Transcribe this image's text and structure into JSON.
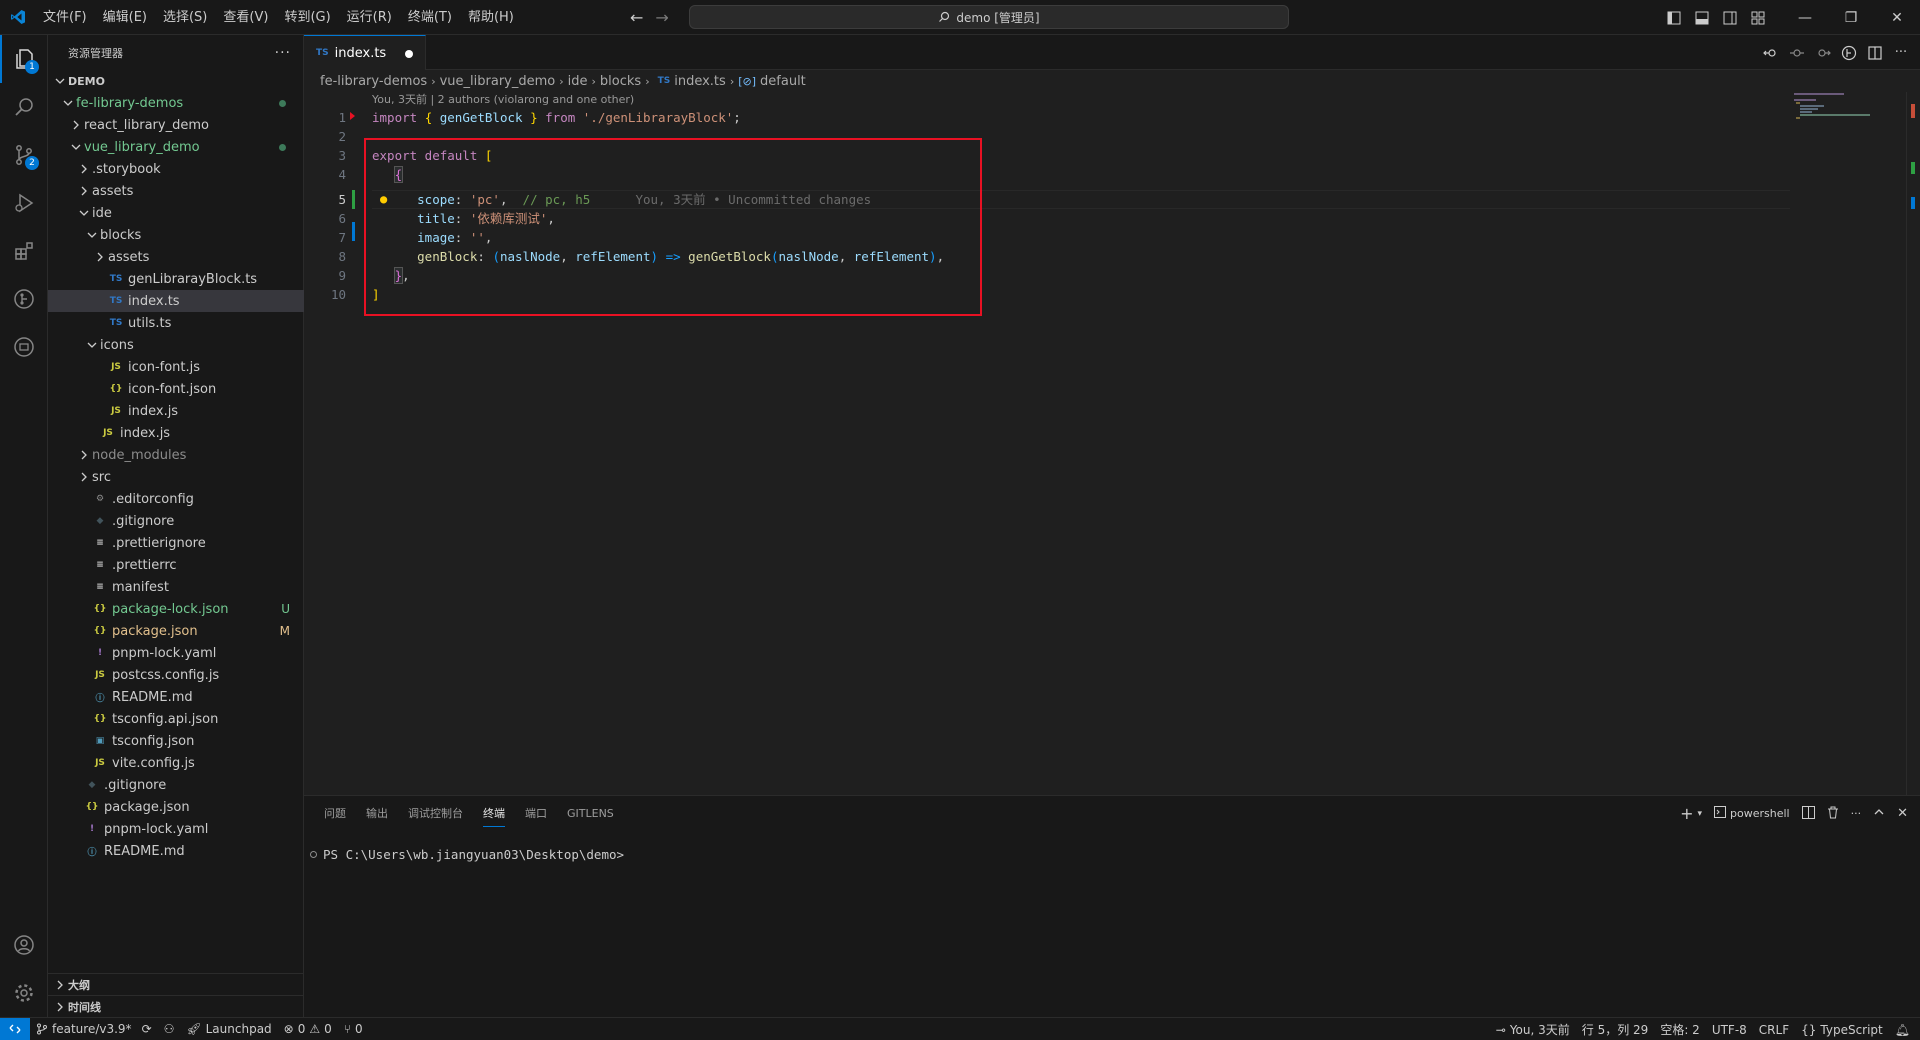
{
  "menu": [
    "文件(F)",
    "编辑(E)",
    "选择(S)",
    "查看(V)",
    "转到(G)",
    "运行(R)",
    "终端(T)",
    "帮助(H)"
  ],
  "command_center": "demo [管理员]",
  "sidebar": {
    "title": "资源管理器",
    "root": "DEMO",
    "items": [
      {
        "label": "fe-library-demos",
        "depth": 1,
        "type": "folder-open",
        "status": "dot",
        "color": "green"
      },
      {
        "label": "react_library_demo",
        "depth": 2,
        "type": "folder",
        "status": "",
        "color": ""
      },
      {
        "label": "vue_library_demo",
        "depth": 2,
        "type": "folder-open",
        "status": "dot",
        "color": "green"
      },
      {
        "label": ".storybook",
        "depth": 3,
        "type": "folder",
        "status": "",
        "color": ""
      },
      {
        "label": "assets",
        "depth": 3,
        "type": "folder",
        "status": "",
        "color": ""
      },
      {
        "label": "ide",
        "depth": 3,
        "type": "folder-open",
        "status": "",
        "color": ""
      },
      {
        "label": "blocks",
        "depth": 4,
        "type": "folder-open",
        "status": "",
        "color": ""
      },
      {
        "label": "assets",
        "depth": 5,
        "type": "folder",
        "status": "",
        "color": ""
      },
      {
        "label": "genLibrarayBlock.ts",
        "depth": 5,
        "type": "ts",
        "status": "",
        "color": ""
      },
      {
        "label": "index.ts",
        "depth": 5,
        "type": "ts",
        "status": "",
        "color": "",
        "selected": true
      },
      {
        "label": "utils.ts",
        "depth": 5,
        "type": "ts",
        "status": "",
        "color": ""
      },
      {
        "label": "icons",
        "depth": 4,
        "type": "folder-open",
        "status": "",
        "color": ""
      },
      {
        "label": "icon-font.js",
        "depth": 5,
        "type": "js",
        "status": "",
        "color": ""
      },
      {
        "label": "icon-font.json",
        "depth": 5,
        "type": "json",
        "status": "",
        "color": ""
      },
      {
        "label": "index.js",
        "depth": 5,
        "type": "js",
        "status": "",
        "color": ""
      },
      {
        "label": "index.js",
        "depth": 4,
        "type": "js",
        "status": "",
        "color": ""
      },
      {
        "label": "node_modules",
        "depth": 3,
        "type": "folder",
        "status": "",
        "color": "gray"
      },
      {
        "label": "src",
        "depth": 3,
        "type": "folder",
        "status": "",
        "color": ""
      },
      {
        "label": ".editorconfig",
        "depth": 3,
        "type": "gear",
        "status": "",
        "color": ""
      },
      {
        "label": ".gitignore",
        "depth": 3,
        "type": "git",
        "status": "",
        "color": ""
      },
      {
        "label": ".prettierignore",
        "depth": 3,
        "type": "lines",
        "status": "",
        "color": ""
      },
      {
        "label": ".prettierrc",
        "depth": 3,
        "type": "lines",
        "status": "",
        "color": ""
      },
      {
        "label": "manifest",
        "depth": 3,
        "type": "lines",
        "status": "",
        "color": ""
      },
      {
        "label": "package-lock.json",
        "depth": 3,
        "type": "json",
        "status": "U",
        "color": "green"
      },
      {
        "label": "package.json",
        "depth": 3,
        "type": "json",
        "status": "M",
        "color": "yellow"
      },
      {
        "label": "pnpm-lock.yaml",
        "depth": 3,
        "type": "yaml",
        "status": "",
        "color": ""
      },
      {
        "label": "postcss.config.js",
        "depth": 3,
        "type": "js",
        "status": "",
        "color": ""
      },
      {
        "label": "README.md",
        "depth": 3,
        "type": "info",
        "status": "",
        "color": ""
      },
      {
        "label": "tsconfig.api.json",
        "depth": 3,
        "type": "json",
        "status": "",
        "color": ""
      },
      {
        "label": "tsconfig.json",
        "depth": 3,
        "type": "tsconfig",
        "status": "",
        "color": ""
      },
      {
        "label": "vite.config.js",
        "depth": 3,
        "type": "js",
        "status": "",
        "color": ""
      },
      {
        "label": ".gitignore",
        "depth": 2,
        "type": "git",
        "status": "",
        "color": ""
      },
      {
        "label": "package.json",
        "depth": 2,
        "type": "json",
        "status": "",
        "color": ""
      },
      {
        "label": "pnpm-lock.yaml",
        "depth": 2,
        "type": "yaml",
        "status": "",
        "color": ""
      },
      {
        "label": "README.md",
        "depth": 2,
        "type": "info",
        "status": "",
        "color": ""
      }
    ],
    "outline": "大纲",
    "timeline": "时间线"
  },
  "editor": {
    "tab_label": "index.ts",
    "tab_badge": "TS",
    "breadcrumb": [
      "fe-library-demos",
      "vue_library_demo",
      "ide",
      "blocks",
      "index.ts",
      "default"
    ],
    "codelens": "You, 3天前 | 2 authors (violarong and one other)",
    "blame": "You, 3天前 • Uncommitted changes",
    "line_numbers": [
      "1",
      "2",
      "3",
      "4",
      "5",
      "6",
      "7",
      "8",
      "9",
      "10"
    ],
    "code": {
      "l1_import": "import",
      "l1_open": "{",
      "l1_name": "genGetBlock",
      "l1_close": "}",
      "l1_from": "from",
      "l1_path": "'./genLibrarayBlock'",
      "l1_semi": ";",
      "l3_export": "export default",
      "l3_bracket": "[",
      "l4_brace": "{",
      "l5_key": "scope",
      "l5_val": "'pc'",
      "l5_comment": "// pc, h5",
      "l6_key": "title",
      "l6_val": "'依赖库测试'",
      "l7_key": "image",
      "l7_val": "''",
      "l8_key": "genBlock",
      "l8_p1": "naslNode",
      "l8_p2": "refElement",
      "l8_arrow": "=>",
      "l8_fn": "genGetBlock",
      "l9_brace": "}",
      "l10_bracket": "]"
    }
  },
  "panel": {
    "tabs": [
      "问题",
      "输出",
      "调试控制台",
      "终端",
      "端口",
      "GITLENS"
    ],
    "active_tab": "终端",
    "shell": "powershell",
    "prompt": "PS C:\\Users\\wb.jiangyuan03\\Desktop\\demo>"
  },
  "status": {
    "branch": "feature/v3.9*",
    "launchpad": "Launchpad",
    "errors": "0",
    "warnings": "0",
    "ports": "0",
    "blame": "You, 3天前",
    "position": "行 5，列 29",
    "spaces": "空格: 2",
    "encoding": "UTF-8",
    "eol": "CRLF",
    "language": "TypeScript"
  },
  "badges": {
    "explorer": "1",
    "scm": "2"
  },
  "colors": {
    "accent": "#0078d4",
    "highlight_box": "#e81123",
    "untracked": "#73c991",
    "modified": "#e2c08d"
  }
}
